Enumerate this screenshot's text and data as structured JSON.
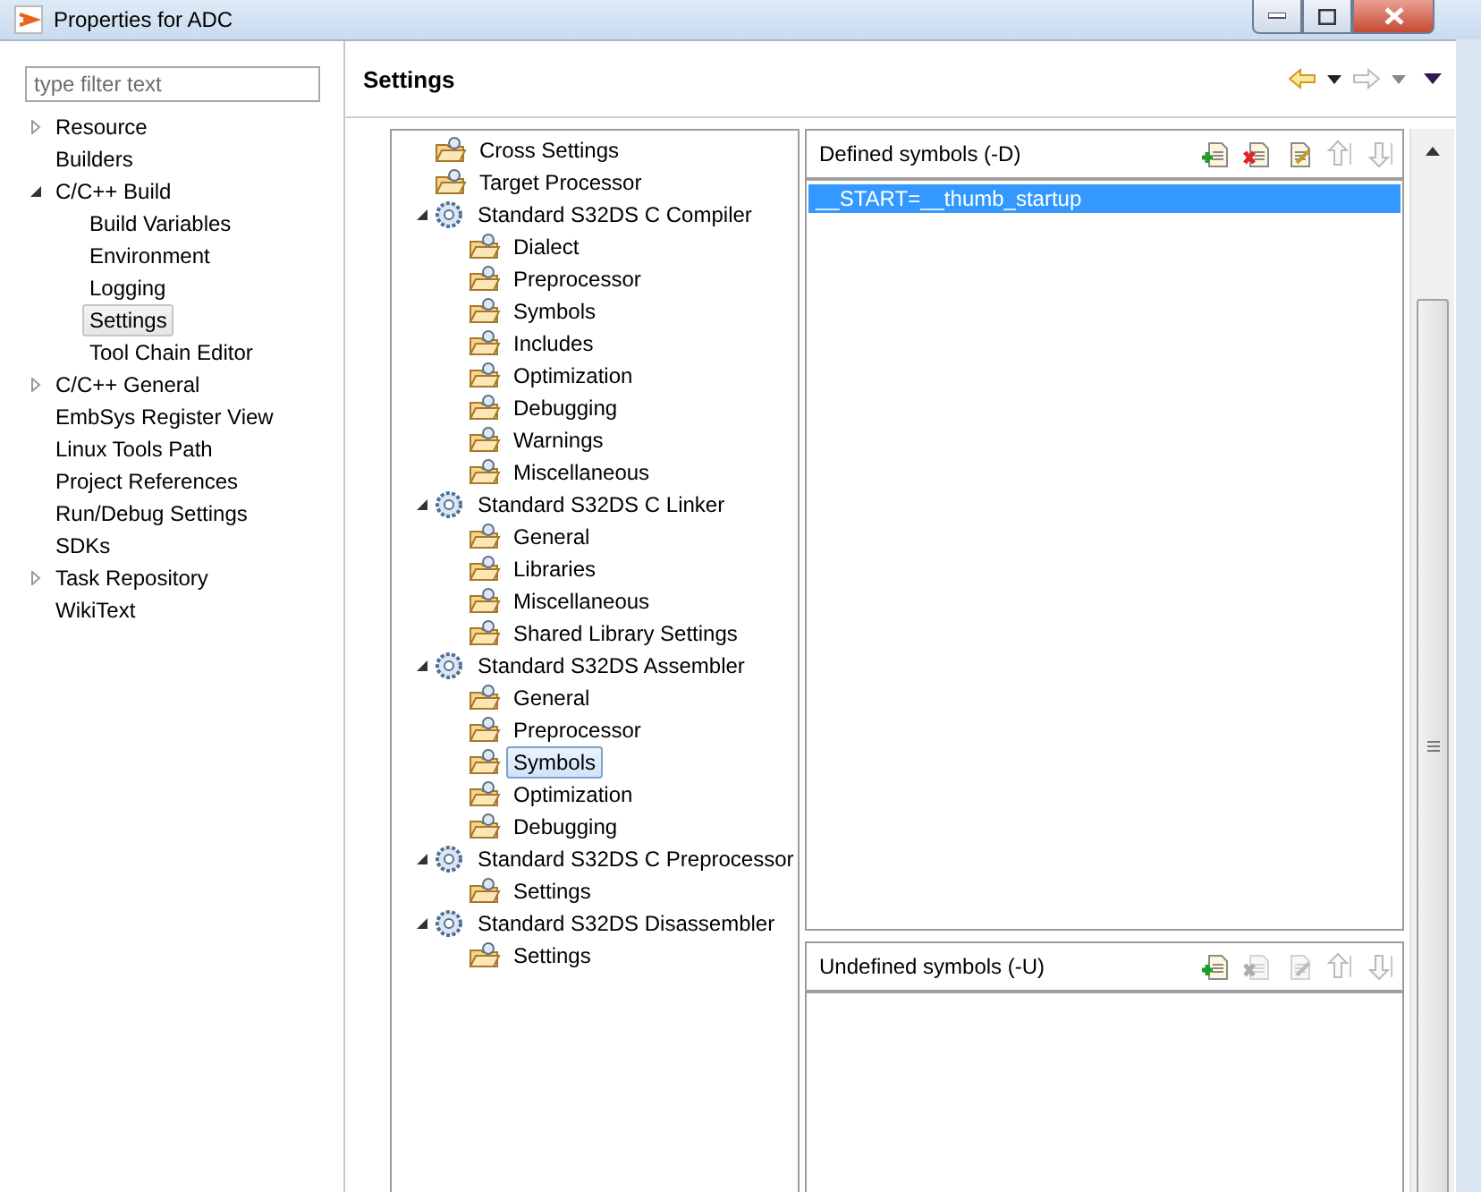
{
  "window": {
    "title": "Properties for ADC"
  },
  "filter": {
    "placeholder": "type filter text"
  },
  "nav_tree": [
    {
      "label": "Resource",
      "expanded": false,
      "selected": false
    },
    {
      "label": "Builders",
      "selected": false
    },
    {
      "label": "C/C++ Build",
      "expanded": true,
      "selected": false,
      "children": [
        {
          "label": "Build Variables",
          "selected": false
        },
        {
          "label": "Environment",
          "selected": false
        },
        {
          "label": "Logging",
          "selected": false
        },
        {
          "label": "Settings",
          "selected": true
        },
        {
          "label": "Tool Chain Editor",
          "selected": false
        }
      ]
    },
    {
      "label": "C/C++ General",
      "expanded": false,
      "selected": false
    },
    {
      "label": "EmbSys Register View",
      "selected": false
    },
    {
      "label": "Linux Tools Path",
      "selected": false
    },
    {
      "label": "Project References",
      "selected": false
    },
    {
      "label": "Run/Debug Settings",
      "selected": false
    },
    {
      "label": "SDKs",
      "selected": false
    },
    {
      "label": "Task Repository",
      "expanded": false,
      "selected": false
    },
    {
      "label": "WikiText",
      "selected": false
    }
  ],
  "page": {
    "title": "Settings"
  },
  "tool_tree": [
    {
      "label": "Cross Settings",
      "kind": "folder",
      "selected": false
    },
    {
      "label": "Target Processor",
      "kind": "folder",
      "selected": false
    },
    {
      "label": "Standard S32DS C Compiler",
      "kind": "tool",
      "expanded": true,
      "selected": false,
      "children": [
        {
          "label": "Dialect",
          "kind": "folder",
          "selected": false
        },
        {
          "label": "Preprocessor",
          "kind": "folder",
          "selected": false
        },
        {
          "label": "Symbols",
          "kind": "folder",
          "selected": false
        },
        {
          "label": "Includes",
          "kind": "folder",
          "selected": false
        },
        {
          "label": "Optimization",
          "kind": "folder",
          "selected": false
        },
        {
          "label": "Debugging",
          "kind": "folder",
          "selected": false
        },
        {
          "label": "Warnings",
          "kind": "folder",
          "selected": false
        },
        {
          "label": "Miscellaneous",
          "kind": "folder",
          "selected": false
        }
      ]
    },
    {
      "label": "Standard S32DS C Linker",
      "kind": "tool",
      "expanded": true,
      "selected": false,
      "children": [
        {
          "label": "General",
          "kind": "folder",
          "selected": false
        },
        {
          "label": "Libraries",
          "kind": "folder",
          "selected": false
        },
        {
          "label": "Miscellaneous",
          "kind": "folder",
          "selected": false
        },
        {
          "label": "Shared Library Settings",
          "kind": "folder",
          "selected": false
        }
      ]
    },
    {
      "label": "Standard S32DS Assembler",
      "kind": "tool",
      "expanded": true,
      "selected": false,
      "children": [
        {
          "label": "General",
          "kind": "folder",
          "selected": false
        },
        {
          "label": "Preprocessor",
          "kind": "folder",
          "selected": false
        },
        {
          "label": "Symbols",
          "kind": "folder",
          "selected": true
        },
        {
          "label": "Optimization",
          "kind": "folder",
          "selected": false
        },
        {
          "label": "Debugging",
          "kind": "folder",
          "selected": false
        }
      ]
    },
    {
      "label": "Standard S32DS C Preprocessor",
      "kind": "tool",
      "expanded": true,
      "selected": false,
      "children": [
        {
          "label": "Settings",
          "kind": "folder",
          "selected": false
        }
      ]
    },
    {
      "label": "Standard S32DS Disassembler",
      "kind": "tool",
      "expanded": true,
      "selected": false,
      "children": [
        {
          "label": "Settings",
          "kind": "folder",
          "selected": false
        }
      ]
    }
  ],
  "lists": [
    {
      "title": "Defined symbols (-D)",
      "tools": [
        {
          "kind": "add",
          "disabled": false
        },
        {
          "kind": "delete",
          "disabled": false
        },
        {
          "kind": "edit",
          "disabled": false
        },
        {
          "kind": "up",
          "disabled": true
        },
        {
          "kind": "down",
          "disabled": true
        }
      ],
      "items": [
        {
          "text": "__START=__thumb_startup",
          "selected": true
        }
      ]
    },
    {
      "title": "Undefined symbols (-U)",
      "tools": [
        {
          "kind": "add",
          "disabled": false
        },
        {
          "kind": "delete",
          "disabled": true
        },
        {
          "kind": "edit",
          "disabled": true
        },
        {
          "kind": "up",
          "disabled": true
        },
        {
          "kind": "down",
          "disabled": true
        }
      ]
    }
  ]
}
